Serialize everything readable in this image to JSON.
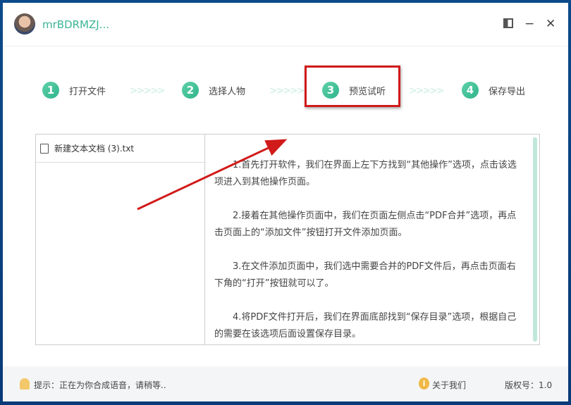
{
  "header": {
    "username": "mrBDRMZJ...",
    "layout_icon": "layout-icon",
    "minimize": "−",
    "close": "✕"
  },
  "steps": [
    {
      "num": "1",
      "label": "打开文件"
    },
    {
      "num": "2",
      "label": "选择人物"
    },
    {
      "num": "3",
      "label": "预览试听"
    },
    {
      "num": "4",
      "label": "保存导出"
    }
  ],
  "separator": ">>>>>",
  "files": [
    {
      "name": "新建文本文档 (3).txt"
    }
  ],
  "paragraphs": [
    "1.首先打开软件，我们在界面上左下方找到“其他操作”选项，点击该选项进入到其他操作页面。",
    "2.接着在其他操作页面中，我们在页面左侧点击“PDF合并”选项，再点击页面上的“添加文件”按钮打开文件添加页面。",
    "3.在文件添加页面中，我们选中需要合并的PDF文件后，再点击页面右下角的“打开”按钮就可以了。",
    "4.将PDF文件打开后，我们在界面底部找到“保存目录”选项，根据自己的需要在该选项后面设置保存目录。"
  ],
  "footer": {
    "tip": "提示：正在为你合成语音，请稍等..",
    "about": "关于我们",
    "version": "版权号：1.0"
  },
  "colors": {
    "accent": "#3cb497",
    "highlight": "#d11a1a"
  }
}
